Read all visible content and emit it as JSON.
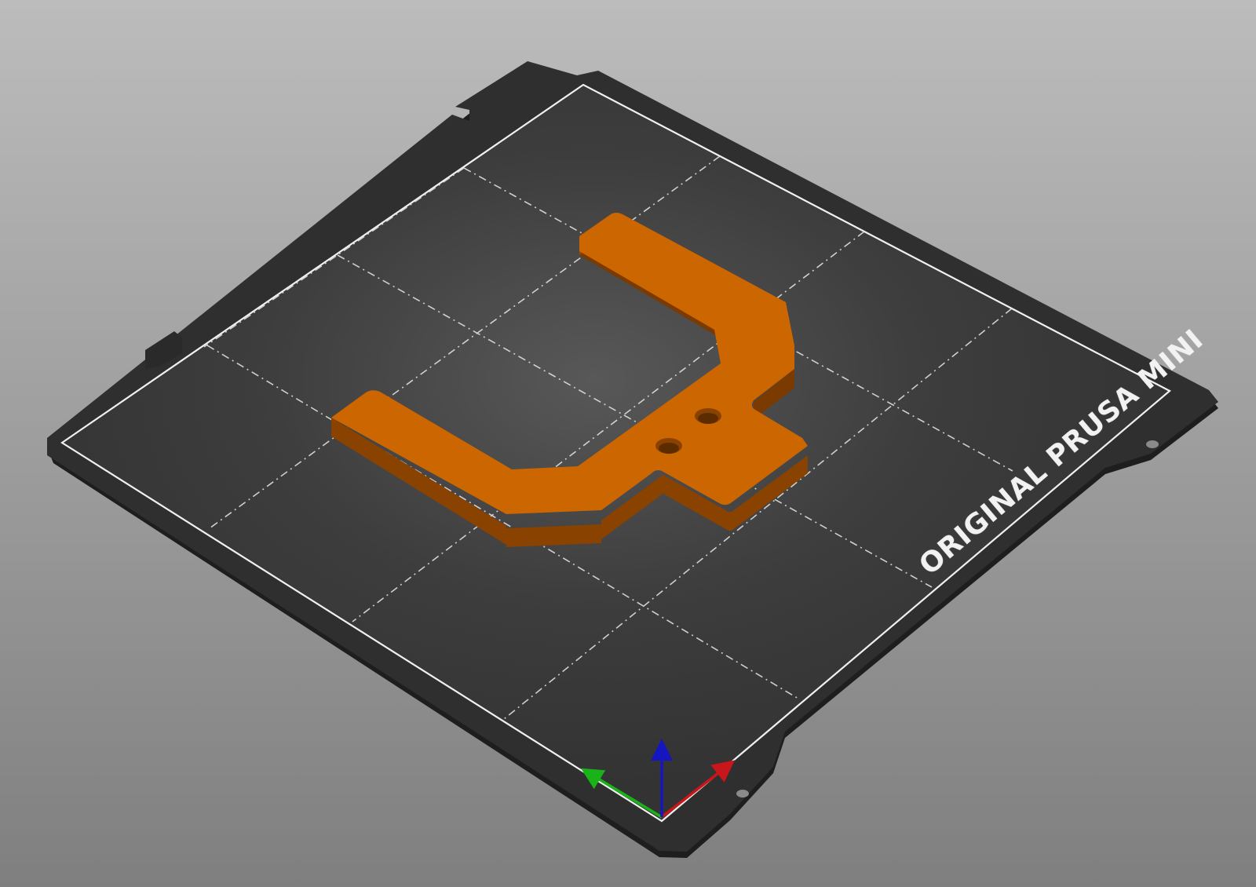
{
  "viewport": {
    "bed_label": "ORIGINAL PRUSA MINI",
    "colors": {
      "background_top": "#b9b9b9",
      "background_bottom": "#828282",
      "bed_sheet": "#2e2e2e",
      "bed_surface": "#3a3a3a",
      "grid_lines": "#e6e6e6",
      "model_top": "#cc6600",
      "model_side": "#8a4200",
      "axis_x": "#c8161b",
      "axis_y": "#19b319",
      "axis_z": "#1616c0"
    },
    "icons": {
      "axes": "xyz-axes-gizmo"
    }
  }
}
